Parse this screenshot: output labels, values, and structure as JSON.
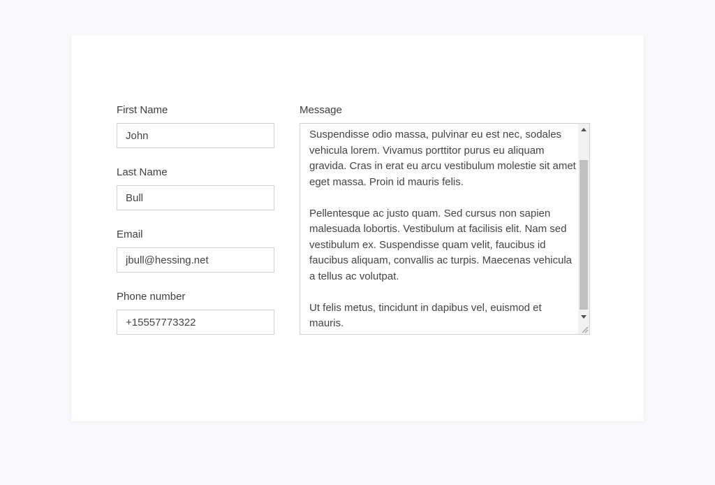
{
  "form": {
    "first_name": {
      "label": "First Name",
      "value": "John"
    },
    "last_name": {
      "label": "Last Name",
      "value": "Bull"
    },
    "email": {
      "label": "Email",
      "value": "jbull@hessing.net"
    },
    "phone": {
      "label": "Phone number",
      "value": "+15557773322"
    },
    "message": {
      "label": "Message",
      "value": "Suspendisse odio massa, pulvinar eu est nec, sodales vehicula lorem. Vivamus porttitor purus eu aliquam gravida. Cras in erat eu arcu vestibulum molestie sit amet eget massa. Proin id mauris felis.\n\nPellentesque ac justo quam. Sed cursus non sapien malesuada lobortis. Vestibulum at facilisis elit. Nam sed vestibulum ex. Suspendisse quam velit, faucibus id faucibus aliquam, convallis ac turpis. Maecenas vehicula a tellus ac volutpat.\n\nUt felis metus, tincidunt in dapibus vel, euismod et mauris."
    }
  },
  "colors": {
    "page_background": "#f8f8fc",
    "card_background": "#ffffff",
    "input_border": "#d2d2d2",
    "label_text": "#3e3e3e",
    "scroll_thumb": "#c1c1c1"
  },
  "icons": {
    "scroll_up": "triangle-up",
    "scroll_down": "triangle-down",
    "resize": "resize-grip"
  }
}
